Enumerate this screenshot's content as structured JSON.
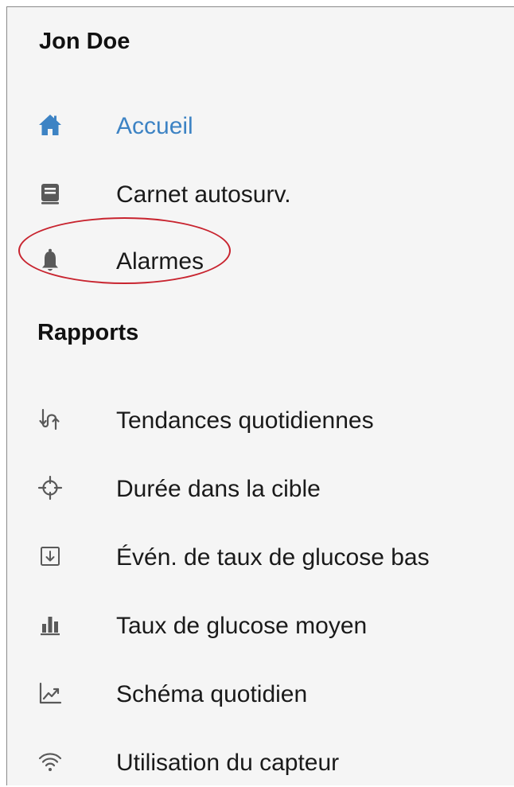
{
  "user": {
    "name": "Jon Doe"
  },
  "menu": [
    {
      "label": "Accueil",
      "icon": "home-icon",
      "active": true
    },
    {
      "label": "Carnet autosurv.",
      "icon": "logbook-icon",
      "active": false
    },
    {
      "label": "Alarmes",
      "icon": "bell-icon",
      "active": false
    }
  ],
  "reports": {
    "title": "Rapports",
    "items": [
      {
        "label": "Tendances quotidiennes",
        "icon": "daily-trends-icon"
      },
      {
        "label": "Durée dans la cible",
        "icon": "target-crosshair-icon"
      },
      {
        "label": "Évén. de taux de glucose bas",
        "icon": "low-glucose-event-icon"
      },
      {
        "label": "Taux de glucose moyen",
        "icon": "bar-chart-icon"
      },
      {
        "label": "Schéma quotidien",
        "icon": "line-chart-icon"
      },
      {
        "label": "Utilisation du capteur",
        "icon": "wireless-signal-icon"
      }
    ]
  },
  "colors": {
    "accent": "#3d83c4",
    "icon": "#595959",
    "text": "#1a1a1a",
    "highlight": "#c8242f",
    "background": "#f5f5f5"
  }
}
